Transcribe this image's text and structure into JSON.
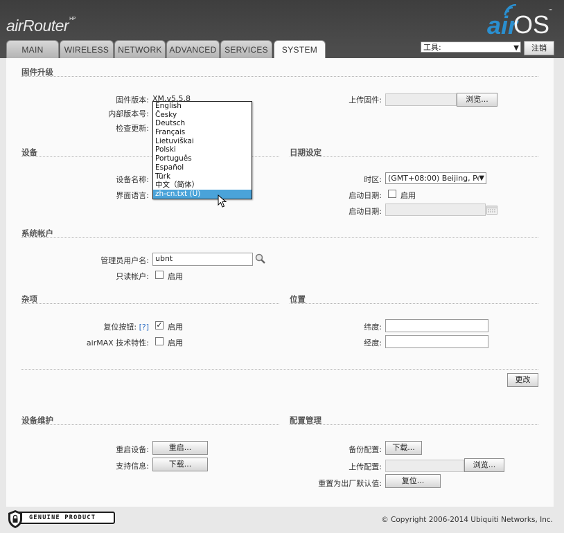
{
  "header": {
    "brand": "airRouter",
    "brand_suffix": "HP",
    "airos_logo_a": "air",
    "airos_logo_b": "OS",
    "airos_tm": "™",
    "tabs": [
      {
        "label": "MAIN"
      },
      {
        "label": "WIRELESS"
      },
      {
        "label": "NETWORK"
      },
      {
        "label": "ADVANCED"
      },
      {
        "label": "SERVICES"
      },
      {
        "label": "SYSTEM"
      }
    ],
    "active_tab": "SYSTEM",
    "tools_select": "工具:",
    "logout_label": "注销"
  },
  "firmware": {
    "title": "固件升级",
    "version_label": "固件版本:",
    "version_value": "XM.v5.5.8",
    "build_label": "内部版本号:",
    "check_label": "检查更新:",
    "upload_label": "上传固件:",
    "browse_label": "浏览..."
  },
  "device": {
    "title": "设备",
    "name_label": "设备名称:",
    "language_label": "界面语言:"
  },
  "language_dropdown": {
    "options": [
      "English",
      "Česky",
      "Deutsch",
      "Français",
      "Lietuviškai",
      "Polski",
      "Português",
      "Español",
      "Türk",
      "中文（简体）",
      "zh-cn.txt (U)"
    ],
    "highlighted": "zh-cn.txt (U)"
  },
  "date": {
    "title": "日期设定",
    "timezone_label": "时区:",
    "timezone_value": "(GMT+08:00) Beijing, Pe",
    "startup_label": "启动日期:",
    "enable_label": "启用",
    "startup_date_label": "启动日期:"
  },
  "account": {
    "title": "系统帐户",
    "admin_label": "管理员用户名:",
    "admin_value": "ubnt",
    "readonly_label": "只读帐户:",
    "enable_label": "启用"
  },
  "misc": {
    "title": "杂项",
    "reset_label": "复位按钮:",
    "reset_help": "[?]",
    "reset_enable": "启用",
    "reset_checked": true,
    "airmax_label": "airMAX 技术特性:",
    "airmax_enable": "启用"
  },
  "location": {
    "title": "位置",
    "lat_label": "纬度:",
    "lon_label": "经度:"
  },
  "change_button": "更改",
  "maintenance": {
    "title": "设备维护",
    "reboot_label": "重启设备:",
    "reboot_button": "重启...",
    "support_label": "支持信息:",
    "support_button": "下载..."
  },
  "config": {
    "title": "配置管理",
    "backup_label": "备份配置:",
    "backup_button": "下载...",
    "upload_label": "上传配置:",
    "browse_label": "浏览...",
    "reset_label": "重置为出厂默认值:",
    "reset_button": "复位..."
  },
  "footer": {
    "copyright": "© Copyright 2006-2014 Ubiquiti Networks, Inc.",
    "badge": "GENUINE  PRODUCT"
  }
}
